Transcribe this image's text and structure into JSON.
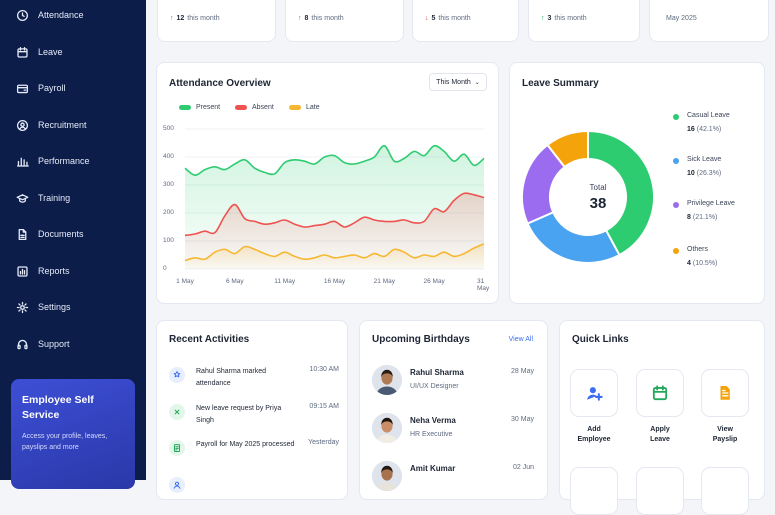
{
  "sidebar": {
    "items": [
      {
        "label": "Attendance",
        "icon": "clock-icon"
      },
      {
        "label": "Leave",
        "icon": "calendar-icon"
      },
      {
        "label": "Payroll",
        "icon": "wallet-icon"
      },
      {
        "label": "Recruitment",
        "icon": "user-search-icon"
      },
      {
        "label": "Performance",
        "icon": "bar-chart-icon"
      },
      {
        "label": "Training",
        "icon": "graduation-cap-icon"
      },
      {
        "label": "Documents",
        "icon": "document-icon"
      },
      {
        "label": "Reports",
        "icon": "reports-icon"
      },
      {
        "label": "Settings",
        "icon": "gear-icon"
      },
      {
        "label": "Support",
        "icon": "headset-icon"
      }
    ],
    "promo": {
      "title": "Employee Self Service",
      "description": "Access your profile, leaves, payslips and more"
    }
  },
  "stats": [
    {
      "trend": "up",
      "value": "12",
      "text": "this month"
    },
    {
      "trend": "up",
      "value": "8",
      "text": "this month"
    },
    {
      "trend": "down",
      "value": "5",
      "text": "this month"
    },
    {
      "trend": "up",
      "value": "3",
      "text": "this month"
    },
    {
      "trend": "none",
      "value": "",
      "text": "May 2025"
    }
  ],
  "attendance": {
    "title": "Attendance Overview",
    "filter": "This Month",
    "legend": [
      "Present",
      "Absent",
      "Late"
    ]
  },
  "chart_data": {
    "type": "area",
    "title": "Attendance Overview",
    "x": [
      "1 May",
      "2 May",
      "3 May",
      "4 May",
      "5 May",
      "6 May",
      "7 May",
      "8 May",
      "9 May",
      "10 May",
      "11 May",
      "12 May",
      "13 May",
      "14 May",
      "15 May",
      "16 May",
      "17 May",
      "18 May",
      "19 May",
      "20 May",
      "21 May",
      "22 May",
      "23 May",
      "24 May",
      "25 May",
      "26 May",
      "27 May",
      "28 May",
      "29 May",
      "30 May",
      "31 May"
    ],
    "xticks": [
      "1 May",
      "6 May",
      "11 May",
      "16 May",
      "21 May",
      "26 May",
      "31 May"
    ],
    "yticks": [
      0,
      100,
      200,
      300,
      400,
      500
    ],
    "ylim": [
      0,
      500
    ],
    "series": [
      {
        "name": "Present",
        "color": "#2ecc71",
        "values": [
          360,
          335,
          355,
          365,
          355,
          375,
          390,
          360,
          345,
          340,
          380,
          390,
          385,
          375,
          400,
          405,
          380,
          375,
          385,
          400,
          440,
          385,
          395,
          420,
          405,
          440,
          420,
          385,
          410,
          370,
          395
        ]
      },
      {
        "name": "Absent",
        "color": "#ef5350",
        "values": [
          120,
          125,
          135,
          130,
          190,
          230,
          180,
          170,
          160,
          165,
          175,
          160,
          150,
          155,
          160,
          170,
          150,
          165,
          185,
          175,
          170,
          170,
          175,
          165,
          170,
          215,
          205,
          245,
          270,
          265,
          255
        ]
      },
      {
        "name": "Late",
        "color": "#f7b731",
        "values": [
          30,
          40,
          35,
          60,
          70,
          55,
          80,
          70,
          55,
          45,
          60,
          45,
          35,
          40,
          50,
          40,
          45,
          50,
          40,
          55,
          45,
          70,
          60,
          40,
          50,
          45,
          60,
          45,
          55,
          75,
          90
        ]
      }
    ],
    "grid": true,
    "legend": "top-left"
  },
  "leave_summary": {
    "title": "Leave Summary",
    "total_label": "Total",
    "total": "38",
    "items": [
      {
        "name": "Casual Leave",
        "count": "16",
        "percent": "(42.1%)",
        "color": "#2ecc71",
        "value": 16
      },
      {
        "name": "Sick Leave",
        "count": "10",
        "percent": "(26.3%)",
        "color": "#4aa3f0",
        "value": 10
      },
      {
        "name": "Privilege Leave",
        "count": "8",
        "percent": "(21.1%)",
        "color": "#9b6cf0",
        "value": 8
      },
      {
        "name": "Others",
        "count": "4",
        "percent": "(10.5%)",
        "color": "#f5a30b",
        "value": 4
      }
    ]
  },
  "activities": {
    "title": "Recent Activities",
    "items": [
      {
        "text": "Rahul Sharma marked attendance",
        "time": "10:30 AM",
        "icon": "attendance-icon",
        "color": "#3b6ff0",
        "bg": "#e7eefe"
      },
      {
        "text": "New leave request by Priya Singh",
        "time": "09:15 AM",
        "icon": "close-icon",
        "color": "#22a85a",
        "bg": "#e3f6ea"
      },
      {
        "text": "Payroll for May 2025 processed",
        "time": "Yesterday",
        "icon": "payroll-icon",
        "color": "#22a85a",
        "bg": "#e3f6ea"
      },
      {
        "text": "",
        "time": "",
        "icon": "user-icon",
        "color": "#3b6ff0",
        "bg": "#e7eefe"
      }
    ]
  },
  "birthdays": {
    "title": "Upcoming Birthdays",
    "view_all": "View All",
    "items": [
      {
        "name": "Rahul Sharma",
        "role": "UI/UX Designer",
        "date": "28 May",
        "skin": "#b07a55",
        "hair": "#2b1d14",
        "shirt": "#4b5a73"
      },
      {
        "name": "Neha Verma",
        "role": "HR Executive",
        "date": "30 May",
        "skin": "#c98e68",
        "hair": "#1e140e",
        "shirt": "#f1ece4"
      },
      {
        "name": "Amit Kumar",
        "role": "",
        "date": "02 Jun",
        "skin": "#a8724f",
        "hair": "#231812",
        "shirt": "#e7e2da"
      }
    ]
  },
  "quick_links": {
    "title": "Quick Links",
    "items": [
      {
        "label": "Add\nEmployee",
        "icon": "add-user-icon",
        "color": "#3b6ff0"
      },
      {
        "label": "Apply\nLeave",
        "icon": "calendar-icon",
        "color": "#22a85a"
      },
      {
        "label": "View\nPayslip",
        "icon": "payslip-icon",
        "color": "#f5a30b"
      }
    ]
  }
}
